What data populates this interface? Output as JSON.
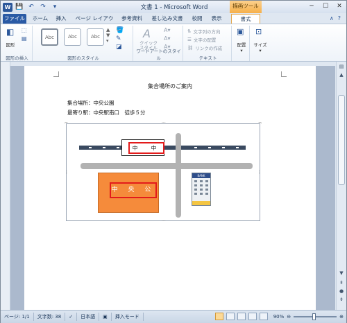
{
  "window": {
    "title": "文書 1 - Microsoft Word",
    "context_tab_header": "描画ツール"
  },
  "quick_access": {
    "app_icon": "W",
    "save_icon": "save-icon",
    "undo_icon": "undo-icon",
    "redo_icon": "redo-icon"
  },
  "tabs": {
    "file": "ファイル",
    "home": "ホーム",
    "insert": "挿入",
    "page_layout": "ページ レイアウト",
    "references": "参考資料",
    "mailings": "差し込み文書",
    "review": "校閲",
    "view": "表示",
    "format": "書式"
  },
  "ribbon": {
    "insert_shapes_group": "図形の挿入",
    "shapes_label": "図形",
    "shape_styles_group": "図形のスタイル",
    "style_samples": [
      "Abc",
      "Abc",
      "Abc"
    ],
    "quick_style_label": "クイック\nスタイル",
    "wordart_group": "ワードアートのスタイル",
    "text_group": "テキスト",
    "text_direction": "文字列の方向",
    "text_align": "文字の配置",
    "create_link": "リンクの作成",
    "arrange_label": "配置",
    "size_label": "サイズ"
  },
  "document": {
    "heading": "集合場所のご案内",
    "line1": "集合場所：中央公園",
    "line2": "最寄り駅：中央駅南口　徒歩５分"
  },
  "map": {
    "station_label": "中　中",
    "park_label": "中 央 公",
    "bank_label": "BANK",
    "colors": {
      "park": "#f58b3b",
      "highlight": "#e31b1b",
      "road": "#b2b2b2",
      "rail": "#3a4a60"
    }
  },
  "status": {
    "page": "ページ: 1/1",
    "word_count": "文字数: 38",
    "language": "日本語",
    "mode": "挿入モード",
    "zoom": "90%"
  }
}
